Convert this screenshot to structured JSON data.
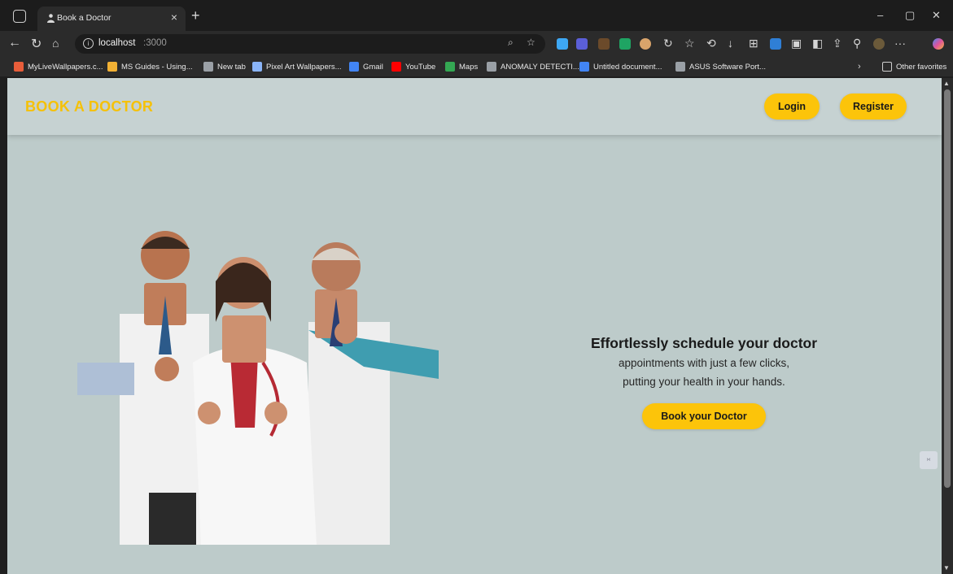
{
  "browser": {
    "tab_title": "Book a Doctor",
    "url_host": "localhost",
    "url_port": ":3000"
  },
  "bookmarks": [
    {
      "label": "MyLiveWallpapers.c...",
      "color": "#e85d3a"
    },
    {
      "label": "MS Guides - Using...",
      "color": "#f2b134"
    },
    {
      "label": "New tab",
      "color": "#9aa0a6"
    },
    {
      "label": "Pixel Art Wallpapers...",
      "color": "#8ab4f8"
    },
    {
      "label": "Gmail",
      "color": "#4285f4"
    },
    {
      "label": "YouTube",
      "color": "#ff0000"
    },
    {
      "label": "Maps",
      "color": "#34a853"
    },
    {
      "label": "ANOMALY DETECTI...",
      "color": "#9aa0a6"
    },
    {
      "label": "Untitled document...",
      "color": "#4285f4"
    },
    {
      "label": "ASUS Software Port...",
      "color": "#9aa0a6"
    }
  ],
  "bookmarks_other": "Other favorites",
  "site": {
    "brand": "BOOK A DOCTOR",
    "login_label": "Login",
    "register_label": "Register",
    "hero_heading": "Effortlessly schedule your doctor",
    "hero_line1": "appointments with just a few clicks,",
    "hero_line2": "putting your health in your hands.",
    "cta_label": "Book your Doctor"
  },
  "colors": {
    "accent": "#fcc40a",
    "brand_text": "#f5c108",
    "page_bg": "#bdcbca",
    "header_bg": "#c6d2d2"
  },
  "icons": [
    "workspaces-icon",
    "back-icon",
    "refresh-icon",
    "home-icon",
    "info-icon",
    "read-aloud-icon",
    "favorite-star-icon",
    "favorites-icon",
    "history-icon",
    "downloads-icon",
    "collections-icon",
    "more-icon",
    "copilot-icon"
  ]
}
